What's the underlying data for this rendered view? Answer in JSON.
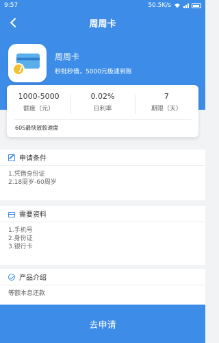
{
  "status_bar": {
    "time": "9:57",
    "speed": "50.5K/s"
  },
  "nav": {
    "title": "周周卡"
  },
  "product": {
    "name": "周周卡",
    "desc": "秒批秒借，5000元极速到账"
  },
  "stats": {
    "items": [
      {
        "value": "1000-5000",
        "label": "额度（元）"
      },
      {
        "value": "0.02%",
        "label": "日利率"
      },
      {
        "value": "7",
        "label": "期限（天）"
      }
    ],
    "speed_note": "60S最快放款速度"
  },
  "conditions": {
    "title": "申请条件",
    "items": [
      "1.凭借身份证",
      "2.18周岁-60周岁"
    ]
  },
  "materials": {
    "title": "需要资料",
    "items": [
      "1.手机号",
      "2.身份证",
      "3.银行卡"
    ]
  },
  "intro": {
    "title": "产品介绍",
    "text": "等额本息还款"
  },
  "apply_button": "去申请",
  "colors": {
    "primary": "#3d8de8",
    "background": "#f2f3f5"
  }
}
